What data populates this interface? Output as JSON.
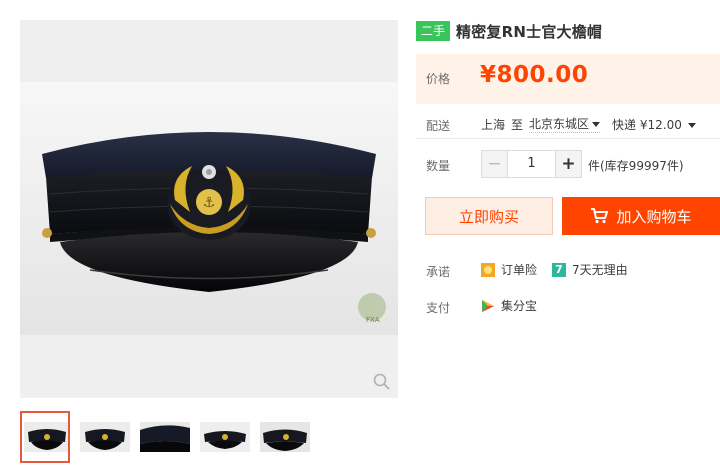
{
  "product": {
    "used_tag": "二手",
    "title": "精密复RN士官大檐帽"
  },
  "price": {
    "label": "价格",
    "value": "¥800.00"
  },
  "shipping": {
    "label": "配送",
    "from": "上海",
    "to_word": "至",
    "destination": "北京东城区",
    "method": "快递 ¥12.00"
  },
  "quantity": {
    "label": "数量",
    "value": "1",
    "minus": "−",
    "plus": "+",
    "stock": "件(库存99997件)"
  },
  "actions": {
    "buy_now": "立即购买",
    "add_to_cart": "加入购物车"
  },
  "promise": {
    "label": "承诺",
    "items": [
      {
        "icon": "order-insurance-icon",
        "text": "订单险"
      },
      {
        "icon": "seven-day-return-icon",
        "badge": "7",
        "text": "7天无理由"
      }
    ]
  },
  "payment": {
    "label": "支付",
    "method": "集分宝",
    "icon": "jifenbao-icon"
  },
  "gallery": {
    "thumbnail_count": 5,
    "active_index": 0,
    "photo_watermark": "FXA"
  },
  "colors": {
    "accent": "#ff4400",
    "price": "#ff4400",
    "used_tag": "#3ac55b",
    "price_bg": "#fff2e8"
  }
}
